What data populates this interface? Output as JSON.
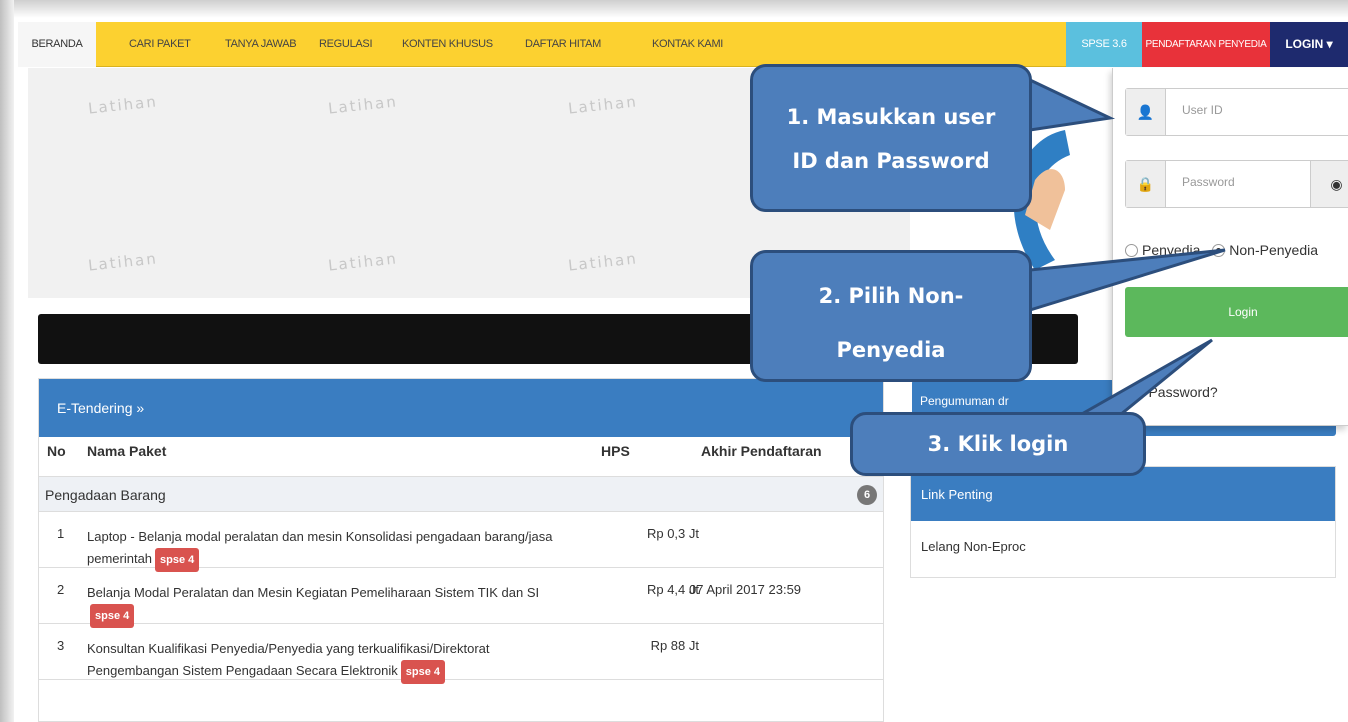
{
  "nav": {
    "home": "BERANDA",
    "items": [
      "CARI PAKET",
      "TANYA JAWAB",
      "REGULASI",
      "KONTEN KHUSUS",
      "DAFTAR HITAM",
      "KONTAK KAMI"
    ],
    "spse_version": "SPSE 3.6",
    "register": "PENDAFTARAN PENYEDIA",
    "login": "LOGIN ▾"
  },
  "banner": {
    "watermark": "Latihan"
  },
  "tender": {
    "title": "E-Tendering »",
    "columns": {
      "no": "No",
      "name": "Nama Paket",
      "hps": "HPS",
      "deadline": "Akhir Pendaftaran"
    },
    "group": {
      "label": "Pengadaan Barang",
      "count": "6"
    },
    "rows": [
      {
        "no": "1",
        "name": "Laptop - Belanja modal peralatan dan mesin Konsolidasi pengadaan barang/jasa pemerintah",
        "badge": "spse 4",
        "hps": "Rp 0,3 Jt",
        "deadline": ""
      },
      {
        "no": "2",
        "name": "Belanja Modal Peralatan dan Mesin Kegiatan Pemeliharaan Sistem TIK dan SI",
        "badge": "spse 4",
        "hps": "Rp 4,4 Jt",
        "deadline": "07 April 2017 23:59"
      },
      {
        "no": "3",
        "name": "Konsultan Kualifikasi Penyedia/Penyedia yang terkualifikasi/Direktorat Pengembangan Sistem Pengadaan Secara Elektronik",
        "badge": "spse 4",
        "hps": "Rp 88 Jt",
        "deadline": ""
      }
    ]
  },
  "announcement": {
    "label": "Pengumuman dr"
  },
  "links": {
    "title": "Link Penting",
    "item": "Lelang Non-Eproc"
  },
  "login_form": {
    "user_placeholder": "User ID",
    "password_placeholder": "Password",
    "radio_penyedia": "Penyedia",
    "radio_non_penyedia": "Non-Penyedia",
    "selected_role": "Non-Penyedia",
    "submit": "Login",
    "forgot": "pa Password?"
  },
  "callouts": {
    "step1_line1": "1. Masukkan user",
    "step1_line2": "ID dan Password",
    "step2_line1": "2. Pilih Non-",
    "step2_line2": "Penyedia",
    "step3": "3. Klik login"
  },
  "colors": {
    "nav_yellow": "#fcd130",
    "spse_blue": "#5bc0de",
    "register_red": "#e8323a",
    "login_navy": "#1e2a6e",
    "panel_blue": "#3a7dc1",
    "login_green": "#5cb85c",
    "callout_blue": "#4d7ebb"
  }
}
